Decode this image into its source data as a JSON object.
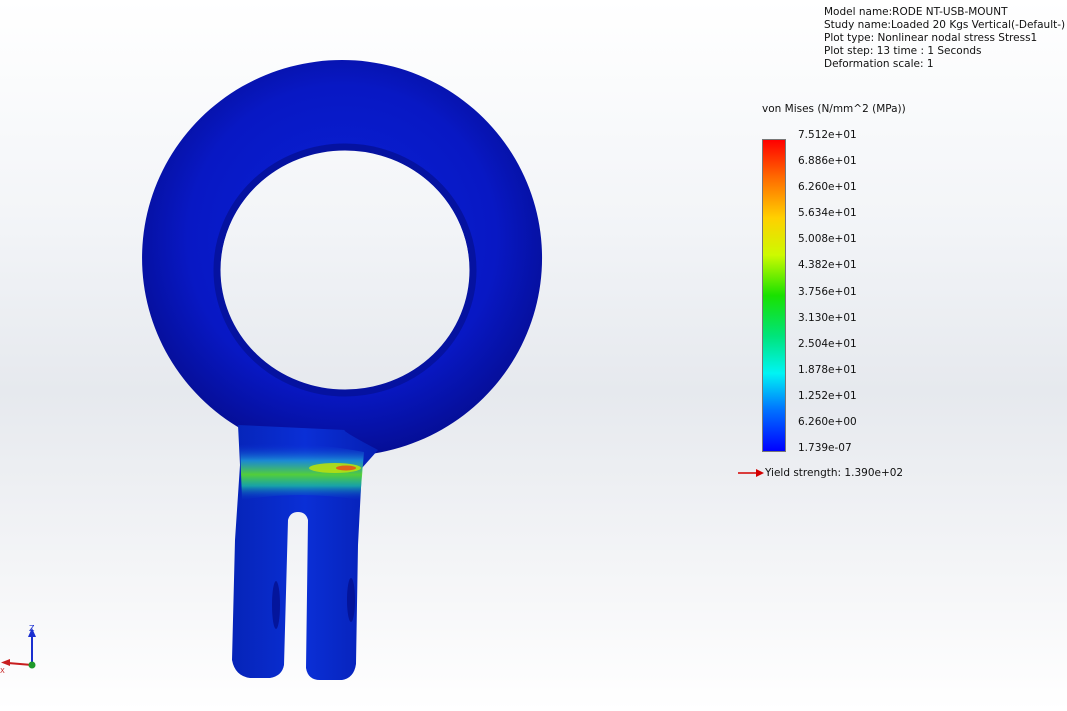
{
  "model_info": {
    "model_name": "Model name:RODE NT-USB-MOUNT",
    "study_name": "Study name:Loaded 20 Kgs Vertical(-Default-)",
    "plot_type": "Plot type: Nonlinear nodal stress Stress1",
    "plot_step": "Plot step: 13   time : 1 Seconds",
    "deformation_scale": "Deformation scale: 1"
  },
  "legend": {
    "title": "von Mises (N/mm^2 (MPa))",
    "ticks": [
      "7.512e+01",
      "6.886e+01",
      "6.260e+01",
      "5.634e+01",
      "5.008e+01",
      "4.382e+01",
      "3.756e+01",
      "3.130e+01",
      "2.504e+01",
      "1.878e+01",
      "1.252e+01",
      "6.260e+00",
      "1.739e-07"
    ],
    "yield_label": "Yield strength: 1.390e+02"
  },
  "triad": {
    "z_label": "Z",
    "x_label": "X"
  },
  "colors": {
    "part_blue": "#0a1ec8",
    "yield_arrow": "#d40000",
    "stress_max": "#ff0000",
    "stress_min": "#0000ff"
  },
  "icons": {
    "yield_marker": "red-arrow-icon",
    "axis_triad": "axis-triad-icon"
  }
}
